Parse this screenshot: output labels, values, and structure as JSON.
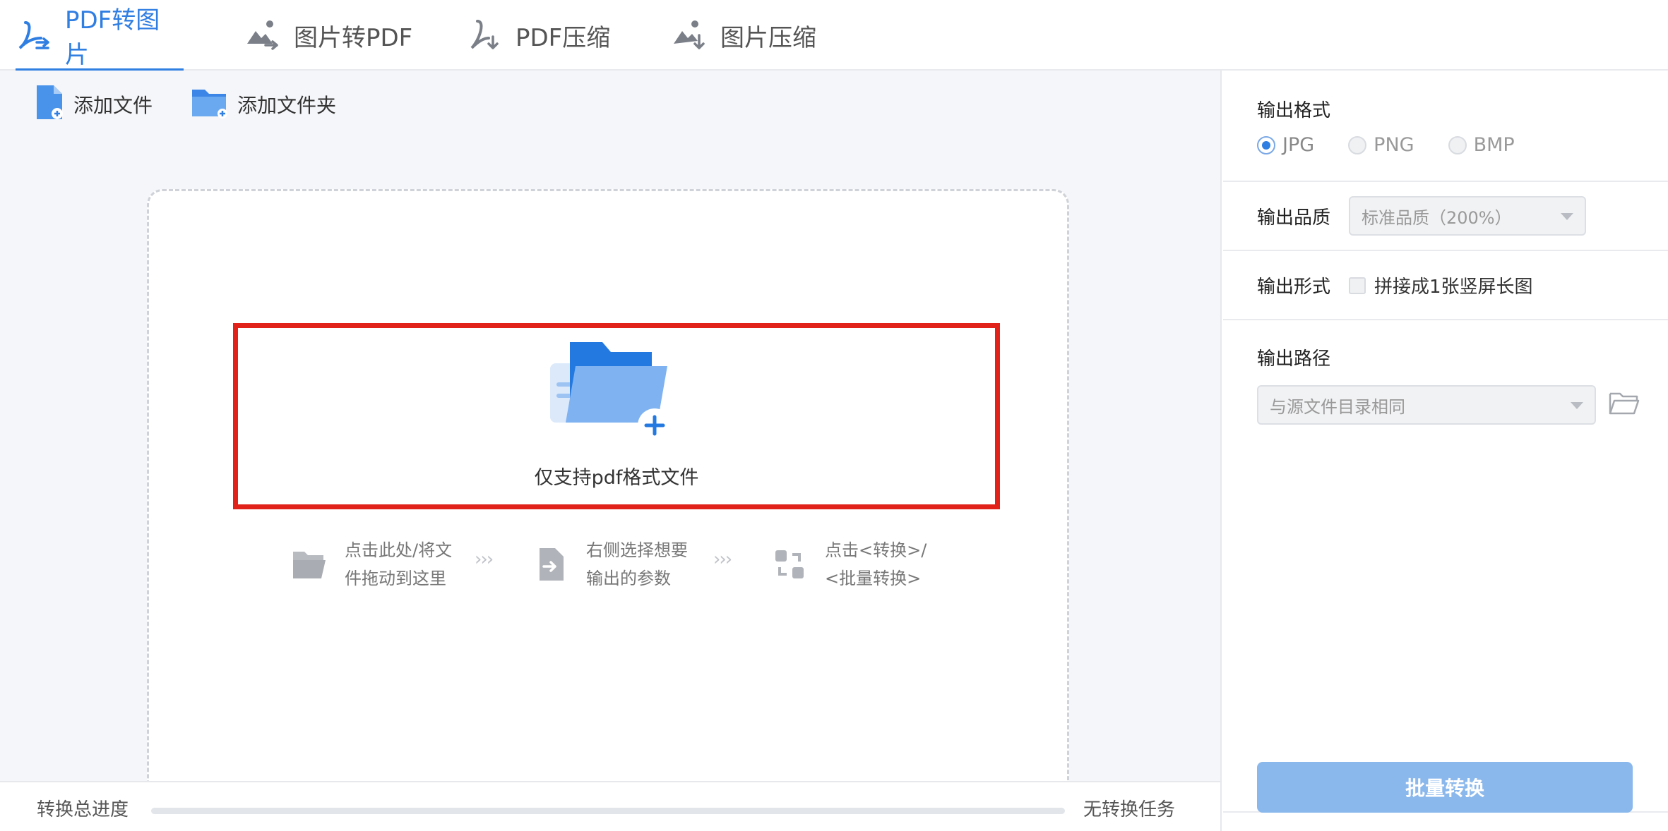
{
  "tabs": [
    {
      "label": "PDF转图片",
      "icon": "pdf-convert-icon",
      "active": true
    },
    {
      "label": "图片转PDF",
      "icon": "image-convert-icon",
      "active": false
    },
    {
      "label": "PDF压缩",
      "icon": "pdf-compress-icon",
      "active": false
    },
    {
      "label": "图片压缩",
      "icon": "image-compress-icon",
      "active": false
    }
  ],
  "toolbar": {
    "add_file": "添加文件",
    "add_folder": "添加文件夹"
  },
  "dropzone": {
    "support_text": "仅支持pdf格式文件",
    "steps": [
      {
        "line1": "点击此处/将文",
        "line2": "件拖动到这里",
        "icon": "open-folder-icon"
      },
      {
        "line1": "右侧选择想要",
        "line2": "输出的参数",
        "icon": "file-arrow-icon"
      },
      {
        "line1": "点击<转换>/",
        "line2": "<批量转换>",
        "icon": "convert-icon"
      }
    ],
    "arrows": "›››"
  },
  "progress": {
    "label": "转换总进度",
    "value": 0,
    "status": "无转换任务"
  },
  "settings": {
    "format_label": "输出格式",
    "formats": [
      {
        "label": "JPG",
        "checked": true
      },
      {
        "label": "PNG",
        "checked": false
      },
      {
        "label": "BMP",
        "checked": false
      }
    ],
    "quality_label": "输出品质",
    "quality_value": "标准品质（200%）",
    "form_label": "输出形式",
    "form_option": "拼接成1张竖屏长图",
    "form_checked": false,
    "path_label": "输出路径",
    "path_value": "与源文件目录相同",
    "convert_button": "批量转换"
  },
  "colors": {
    "accent": "#2f7ee2",
    "highlight": "#e0221a",
    "button_disabled": "#8bb8ec"
  }
}
